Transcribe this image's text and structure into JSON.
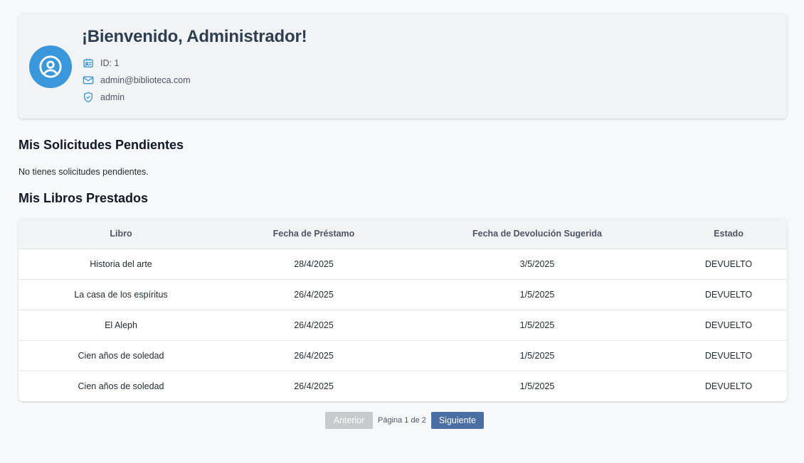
{
  "colors": {
    "avatar_bg": "#3a97dc",
    "icon_accent": "#3a97dc",
    "next_button": "#4a6fa5",
    "prev_button_disabled": "#c9cacc"
  },
  "profile": {
    "avatar_icon": "user-circle-icon",
    "welcome": "¡Bienvenido, Administrador!",
    "id_icon": "id-card-icon",
    "id_text": "ID: 1",
    "email_icon": "mail-icon",
    "email": "admin@biblioteca.com",
    "role_icon": "shield-check-icon",
    "role": "admin"
  },
  "pending": {
    "title": "Mis Solicitudes Pendientes",
    "empty_message": "No tienes solicitudes pendientes."
  },
  "loans": {
    "title": "Mis Libros Prestados",
    "headers": [
      "Libro",
      "Fecha de Préstamo",
      "Fecha de Devolución Sugerida",
      "Estado"
    ],
    "rows": [
      [
        "Historia del arte",
        "28/4/2025",
        "3/5/2025",
        "DEVUELTO"
      ],
      [
        "La casa de los espíritus",
        "26/4/2025",
        "1/5/2025",
        "DEVUELTO"
      ],
      [
        "El Aleph",
        "26/4/2025",
        "1/5/2025",
        "DEVUELTO"
      ],
      [
        "Cien años de soledad",
        "26/4/2025",
        "1/5/2025",
        "DEVUELTO"
      ],
      [
        "Cien años de soledad",
        "26/4/2025",
        "1/5/2025",
        "DEVUELTO"
      ]
    ]
  },
  "pagination": {
    "prev_label": "Anterior",
    "page_info": "Página 1 de 2",
    "next_label": "Siguiente",
    "prev_disabled": true
  }
}
